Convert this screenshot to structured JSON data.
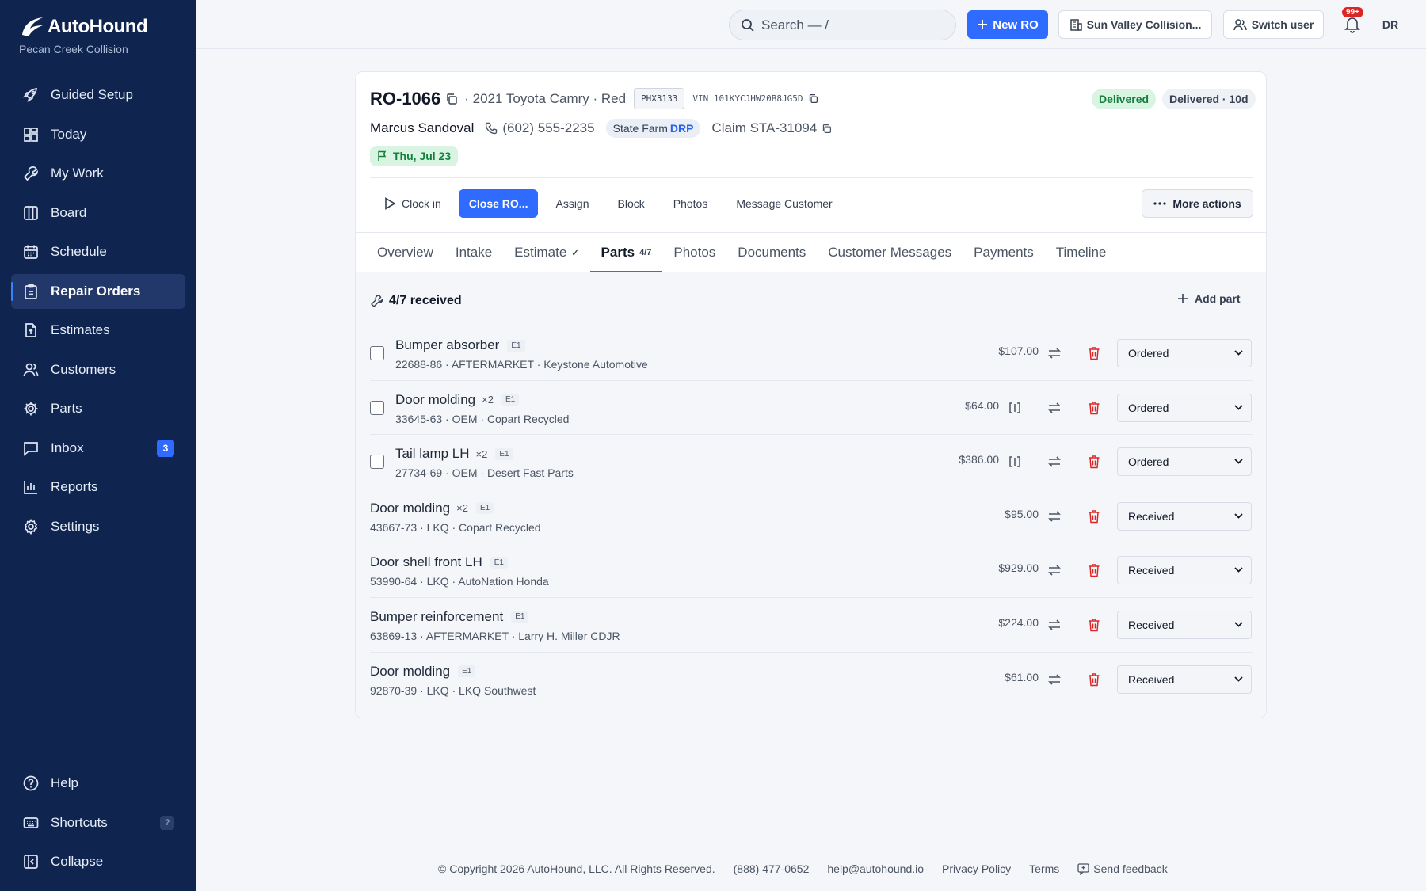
{
  "brand": {
    "name": "AutoHound",
    "shop": "Pecan Creek Collision"
  },
  "nav": [
    {
      "label": "Guided Setup",
      "icon": "rocket-icon"
    },
    {
      "label": "Today",
      "icon": "dashboard-icon"
    },
    {
      "label": "My Work",
      "icon": "wrench-icon"
    },
    {
      "label": "Board",
      "icon": "kanban-icon"
    },
    {
      "label": "Schedule",
      "icon": "calendar-icon"
    },
    {
      "label": "Repair Orders",
      "icon": "clipboard-icon",
      "active": true
    },
    {
      "label": "Estimates",
      "icon": "estimate-icon"
    },
    {
      "label": "Customers",
      "icon": "users-icon"
    },
    {
      "label": "Parts",
      "icon": "gear-icon"
    },
    {
      "label": "Inbox",
      "icon": "message-icon",
      "badge": "3"
    },
    {
      "label": "Reports",
      "icon": "bar-chart-icon"
    },
    {
      "label": "Settings",
      "icon": "settings-icon"
    }
  ],
  "nav_bottom": [
    {
      "label": "Help",
      "icon": "help-icon"
    },
    {
      "label": "Shortcuts",
      "icon": "keyboard-icon",
      "kbd": "?"
    },
    {
      "label": "Collapse",
      "icon": "collapse-icon"
    }
  ],
  "topbar": {
    "search_placeholder": "Search — /",
    "new_ro": "New RO",
    "shop_switch": "Sun Valley Collision...",
    "switch_user": "Switch user",
    "notif_badge": "99+",
    "avatar": "DR"
  },
  "ro": {
    "number": "RO-1066",
    "vehicle": "· 2021 Toyota Camry · Red",
    "plate": "PHX3133",
    "vin": "VIN 101KYCJHW20B8JG5D",
    "status": "Delivered",
    "status_time": "Delivered · 10d",
    "customer": "Marcus Sandoval",
    "phone": "(602) 555-2235",
    "insurer": "State Farm",
    "insurer_type": "DRP",
    "claim": "Claim STA-31094",
    "date": "Thu, Jul 23"
  },
  "actions": {
    "clock_in": "Clock in",
    "close_ro": "Close RO...",
    "assign": "Assign",
    "block": "Block",
    "photos": "Photos",
    "message": "Message Customer",
    "more": "More actions"
  },
  "tabs": [
    {
      "label": "Overview"
    },
    {
      "label": "Intake"
    },
    {
      "label": "Estimate",
      "sub": "✓"
    },
    {
      "label": "Parts",
      "sub": "4/7",
      "active": true
    },
    {
      "label": "Photos"
    },
    {
      "label": "Documents"
    },
    {
      "label": "Customer Messages"
    },
    {
      "label": "Payments"
    },
    {
      "label": "Timeline"
    }
  ],
  "parts_panel": {
    "received_summary": "4/7 received",
    "add_part": "Add part"
  },
  "parts": [
    {
      "name": "Bumper absorber",
      "qty": "",
      "tag": "E1",
      "meta": "22688-86 · AFTERMARKET · Keystone Automotive",
      "price": "$107.00",
      "status": "Ordered",
      "checkbox": true,
      "split": false
    },
    {
      "name": "Door molding",
      "qty": "×2",
      "tag": "E1",
      "meta": "33645-63 · OEM · Copart Recycled",
      "price": "$64.00",
      "status": "Ordered",
      "checkbox": true,
      "split": true
    },
    {
      "name": "Tail lamp LH",
      "qty": "×2",
      "tag": "E1",
      "meta": "27734-69 · OEM · Desert Fast Parts",
      "price": "$386.00",
      "status": "Ordered",
      "checkbox": true,
      "split": true
    },
    {
      "name": "Door molding",
      "qty": "×2",
      "tag": "E1",
      "meta": "43667-73 · LKQ · Copart Recycled",
      "price": "$95.00",
      "status": "Received",
      "checkbox": false,
      "split": false
    },
    {
      "name": "Door shell front LH",
      "qty": "",
      "tag": "E1",
      "meta": "53990-64 · LKQ · AutoNation Honda",
      "price": "$929.00",
      "status": "Received",
      "checkbox": false,
      "split": false
    },
    {
      "name": "Bumper reinforcement",
      "qty": "",
      "tag": "E1",
      "meta": "63869-13 · AFTERMARKET · Larry H. Miller CDJR",
      "price": "$224.00",
      "status": "Received",
      "checkbox": false,
      "split": false
    },
    {
      "name": "Door molding",
      "qty": "",
      "tag": "E1",
      "meta": "92870-39 · LKQ · LKQ Southwest",
      "price": "$61.00",
      "status": "Received",
      "checkbox": false,
      "split": false
    }
  ],
  "footer": {
    "copyright": "© Copyright 2026 AutoHound, LLC. All Rights Reserved.",
    "phone": "(888) 477-0652",
    "email": "help@autohound.io",
    "privacy": "Privacy Policy",
    "terms": "Terms",
    "feedback": "Send feedback"
  },
  "colors": {
    "sidebar": "#0f2550",
    "accent": "#2f6bff",
    "success": "#15803d",
    "danger": "#dc2626"
  }
}
